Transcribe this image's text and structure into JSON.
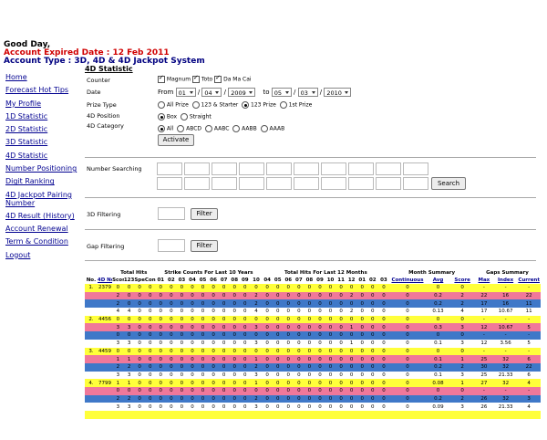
{
  "header": {
    "greeting": "Good Day,",
    "expired": "Account Expired Date : 12 Feb 2011",
    "account_type": "Account Type : 3D, 4D & 4D Jackpot System"
  },
  "nav": [
    "Home",
    "Forecast Hot Tips",
    "My Profile",
    "1D Statistic",
    "2D Statistic",
    "3D Statistic",
    "4D Statistic",
    "Number Positioning",
    "Digit Ranking",
    "4D Jackpot Pairing Number",
    "4D Result (History)",
    "Account Renewal",
    "Term & Condition",
    "Logout"
  ],
  "section_title": "4D Statistic",
  "form": {
    "counter_label": "Counter",
    "counters": [
      "Magnum",
      "Toto",
      "Da Ma Cai"
    ],
    "date_label": "Date",
    "from": "From",
    "to": "to",
    "from_day": "01",
    "from_month": "04",
    "from_year": "2009",
    "to_day": "05",
    "to_month": "03",
    "to_year": "2010",
    "prize_type_label": "Prize Type",
    "prize_types": [
      "All Prize",
      "123 & Starter",
      "123 Prize",
      "1st Prize"
    ],
    "position_label": "4D Position",
    "positions": [
      "Box",
      "Straight"
    ],
    "category_label": "4D Category",
    "categories": [
      "All",
      "ABCD",
      "AABC",
      "AABB",
      "AAAB"
    ],
    "activate": "Activate",
    "number_search_label": "Number Searching",
    "search_button": "Search",
    "filter3d_label": "3D Filtering",
    "gap_label": "Gap Filtering",
    "filter_button": "Filter"
  },
  "table": {
    "groups": {
      "total_hits": "Total Hits",
      "strike": "Strike Counts For Last 10 Years",
      "last12": "Total Hits For Last 12 Months",
      "month_summary": "Month Summary",
      "gaps_summary": "Gaps Summary"
    },
    "columns": [
      "No.",
      "4D No",
      "Score",
      "123",
      "Spe",
      "Con",
      "01",
      "02",
      "03",
      "04",
      "05",
      "06",
      "07",
      "08",
      "09",
      "10",
      "04",
      "05",
      "06",
      "07",
      "08",
      "09",
      "10",
      "11",
      "12",
      "01",
      "02",
      "03",
      "Continuous",
      "Avg",
      "Score",
      "Max",
      "Index",
      "Current"
    ],
    "rows": [
      {
        "c": "y",
        "v": [
          "1.",
          "2379",
          "0",
          "0",
          "0",
          "0",
          "0",
          "0",
          "0",
          "0",
          "0",
          "0",
          "0",
          "0",
          "0",
          "0",
          "0",
          "0",
          "0",
          "0",
          "0",
          "0",
          "0",
          "0",
          "0",
          "0",
          "0",
          "0",
          "0",
          "0",
          "0",
          "-",
          "-",
          "-"
        ]
      },
      {
        "c": "p",
        "v": [
          "",
          "",
          "2",
          "0",
          "0",
          "0",
          "0",
          "0",
          "0",
          "0",
          "0",
          "0",
          "0",
          "0",
          "0",
          "2",
          "0",
          "0",
          "0",
          "0",
          "0",
          "0",
          "0",
          "0",
          "2",
          "0",
          "0",
          "0",
          "0",
          "0.2",
          "2",
          "22",
          "16",
          "22"
        ]
      },
      {
        "c": "b",
        "v": [
          "",
          "",
          "2",
          "0",
          "0",
          "0",
          "0",
          "0",
          "0",
          "0",
          "0",
          "0",
          "0",
          "0",
          "0",
          "2",
          "0",
          "0",
          "0",
          "0",
          "0",
          "0",
          "0",
          "0",
          "0",
          "0",
          "0",
          "0",
          "0",
          "0.2",
          "2",
          "17",
          "16",
          "11"
        ]
      },
      {
        "c": "w",
        "v": [
          "",
          "",
          "4",
          "4",
          "0",
          "0",
          "0",
          "0",
          "0",
          "0",
          "0",
          "0",
          "0",
          "0",
          "0",
          "4",
          "0",
          "0",
          "0",
          "0",
          "0",
          "0",
          "0",
          "0",
          "2",
          "0",
          "0",
          "0",
          "0",
          "0.13",
          "4",
          "17",
          "10.67",
          "11"
        ]
      },
      {
        "c": "y",
        "v": [
          "2.",
          "4456",
          "0",
          "0",
          "0",
          "0",
          "0",
          "0",
          "0",
          "0",
          "0",
          "0",
          "0",
          "0",
          "0",
          "0",
          "0",
          "0",
          "0",
          "0",
          "0",
          "0",
          "0",
          "0",
          "0",
          "0",
          "0",
          "0",
          "0",
          "0",
          "0",
          "-",
          "-",
          "-"
        ]
      },
      {
        "c": "p",
        "v": [
          "",
          "",
          "3",
          "3",
          "0",
          "0",
          "0",
          "0",
          "0",
          "0",
          "0",
          "0",
          "0",
          "0",
          "0",
          "3",
          "0",
          "0",
          "0",
          "0",
          "0",
          "0",
          "0",
          "0",
          "1",
          "0",
          "0",
          "0",
          "0",
          "0.3",
          "3",
          "12",
          "10.67",
          "5"
        ]
      },
      {
        "c": "b",
        "v": [
          "",
          "",
          "0",
          "0",
          "0",
          "0",
          "0",
          "0",
          "0",
          "0",
          "0",
          "0",
          "0",
          "0",
          "0",
          "0",
          "0",
          "0",
          "0",
          "0",
          "0",
          "0",
          "0",
          "0",
          "0",
          "0",
          "0",
          "0",
          "0",
          "0",
          "0",
          "-",
          "-",
          "-"
        ]
      },
      {
        "c": "w",
        "v": [
          "",
          "",
          "3",
          "3",
          "0",
          "0",
          "0",
          "0",
          "0",
          "0",
          "0",
          "0",
          "0",
          "0",
          "0",
          "3",
          "0",
          "0",
          "0",
          "0",
          "0",
          "0",
          "0",
          "0",
          "1",
          "0",
          "0",
          "0",
          "0",
          "0.1",
          "3",
          "12",
          "3.56",
          "5"
        ]
      },
      {
        "c": "y",
        "v": [
          "3.",
          "4459",
          "0",
          "0",
          "0",
          "0",
          "0",
          "0",
          "0",
          "0",
          "0",
          "0",
          "0",
          "0",
          "0",
          "0",
          "0",
          "0",
          "0",
          "0",
          "0",
          "0",
          "0",
          "0",
          "0",
          "0",
          "0",
          "0",
          "0",
          "0",
          "0",
          "-",
          "-",
          "-"
        ]
      },
      {
        "c": "p",
        "v": [
          "",
          "",
          "1",
          "1",
          "0",
          "0",
          "0",
          "0",
          "0",
          "0",
          "0",
          "0",
          "0",
          "0",
          "0",
          "1",
          "0",
          "0",
          "0",
          "0",
          "0",
          "0",
          "0",
          "0",
          "0",
          "0",
          "0",
          "0",
          "0",
          "0.1",
          "1",
          "25",
          "32",
          "6"
        ]
      },
      {
        "c": "b",
        "v": [
          "",
          "",
          "2",
          "2",
          "0",
          "0",
          "0",
          "0",
          "0",
          "0",
          "0",
          "0",
          "0",
          "0",
          "0",
          "2",
          "0",
          "0",
          "0",
          "0",
          "0",
          "0",
          "0",
          "0",
          "0",
          "0",
          "0",
          "0",
          "0",
          "0.2",
          "2",
          "30",
          "32",
          "22"
        ]
      },
      {
        "c": "w",
        "v": [
          "",
          "",
          "3",
          "3",
          "0",
          "0",
          "0",
          "0",
          "0",
          "0",
          "0",
          "0",
          "0",
          "0",
          "0",
          "3",
          "0",
          "0",
          "0",
          "0",
          "0",
          "0",
          "0",
          "0",
          "0",
          "0",
          "0",
          "0",
          "0",
          "0.1",
          "3",
          "25",
          "21.33",
          "6"
        ]
      },
      {
        "c": "y",
        "v": [
          "4.",
          "7799",
          "1",
          "1",
          "0",
          "0",
          "0",
          "0",
          "0",
          "0",
          "0",
          "0",
          "0",
          "0",
          "0",
          "1",
          "0",
          "0",
          "0",
          "0",
          "0",
          "0",
          "0",
          "0",
          "0",
          "0",
          "0",
          "0",
          "0",
          "0.08",
          "1",
          "27",
          "32",
          "4"
        ]
      },
      {
        "c": "p",
        "v": [
          "",
          "",
          "0",
          "0",
          "0",
          "0",
          "0",
          "0",
          "0",
          "0",
          "0",
          "0",
          "0",
          "0",
          "0",
          "0",
          "0",
          "0",
          "0",
          "0",
          "0",
          "0",
          "0",
          "0",
          "0",
          "0",
          "0",
          "0",
          "0",
          "0",
          "0",
          "-",
          "-",
          "-"
        ]
      },
      {
        "c": "b",
        "v": [
          "",
          "",
          "2",
          "2",
          "0",
          "0",
          "0",
          "0",
          "0",
          "0",
          "0",
          "0",
          "0",
          "0",
          "0",
          "2",
          "0",
          "0",
          "0",
          "0",
          "0",
          "0",
          "0",
          "0",
          "0",
          "0",
          "0",
          "0",
          "0",
          "0.2",
          "2",
          "26",
          "32",
          "3"
        ]
      },
      {
        "c": "w",
        "v": [
          "",
          "",
          "3",
          "3",
          "0",
          "0",
          "0",
          "0",
          "0",
          "0",
          "0",
          "0",
          "0",
          "0",
          "0",
          "3",
          "0",
          "0",
          "0",
          "0",
          "0",
          "0",
          "0",
          "0",
          "0",
          "0",
          "0",
          "0",
          "0",
          "0.09",
          "3",
          "26",
          "21.33",
          "4"
        ]
      },
      {
        "c": "y",
        "v": [
          "",
          "",
          "",
          "",
          "",
          "",
          "",
          "",
          "",
          "",
          "",
          "",
          "",
          "",
          "",
          "",
          "",
          "",
          "",
          "",
          "",
          "",
          "",
          "",
          "",
          "",
          "",
          "",
          "",
          "",
          "",
          "",
          "",
          ""
        ]
      }
    ]
  }
}
